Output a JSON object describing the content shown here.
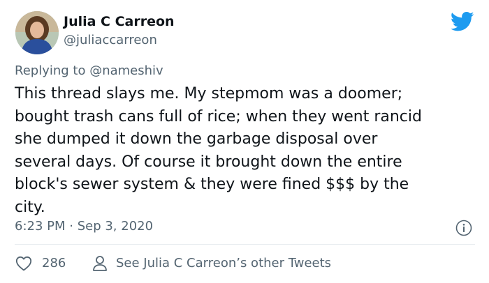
{
  "author": {
    "display_name": "Julia C Carreon",
    "handle": "@juliaccarreon"
  },
  "reply": {
    "prefix": "Replying to ",
    "mention": "@nameshiv"
  },
  "tweet_lines": [
    "This thread slays me. My stepmom was a doomer;",
    "bought trash cans full of rice; when they went rancid",
    "she dumped it down the garbage disposal over",
    "several days. Of course it brought down the entire",
    "block's sewer system & they were fined $$$ by the",
    "city."
  ],
  "meta": {
    "timestamp": "6:23 PM · Sep 3, 2020"
  },
  "actions": {
    "like_count": "286",
    "see_other": "See Julia C Carreon’s other Tweets"
  },
  "colors": {
    "twitter_blue": "#1d9bf0",
    "secondary_text": "#536471",
    "primary_text": "#0f1419"
  },
  "icons": [
    "twitter-bird-icon",
    "info-icon",
    "heart-icon",
    "person-icon"
  ]
}
